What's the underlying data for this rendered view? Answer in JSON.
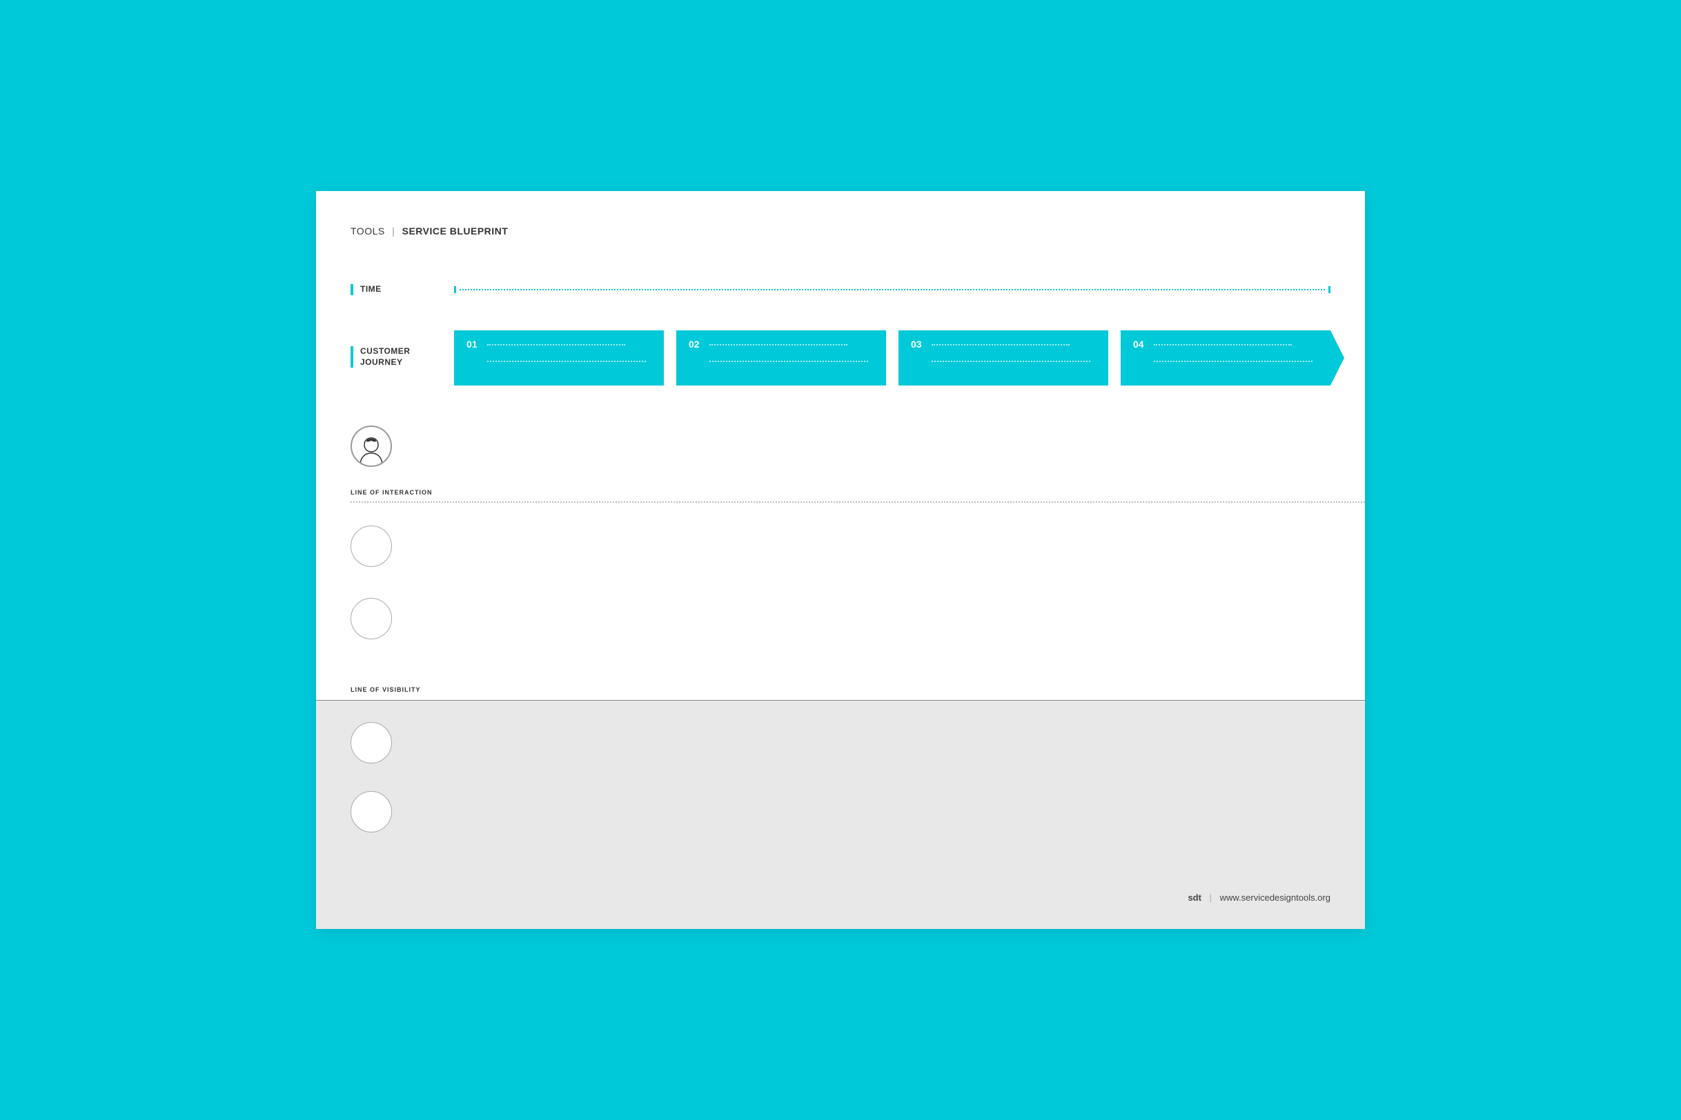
{
  "header": {
    "tools_label": "TOOLS",
    "title": "SERVICE BLUEPRINT"
  },
  "rows": {
    "time_label": "TIME",
    "journey_label_line1": "CUSTOMER",
    "journey_label_line2": "JOURNEY"
  },
  "journey_steps": [
    {
      "num": "01"
    },
    {
      "num": "02"
    },
    {
      "num": "03"
    },
    {
      "num": "04"
    }
  ],
  "sections": {
    "line_of_interaction": "LINE OF INTERACTION",
    "line_of_visibility": "LINE OF VISIBILITY"
  },
  "footer": {
    "logo": "sdt",
    "url": "www.servicedesigntools.org"
  }
}
